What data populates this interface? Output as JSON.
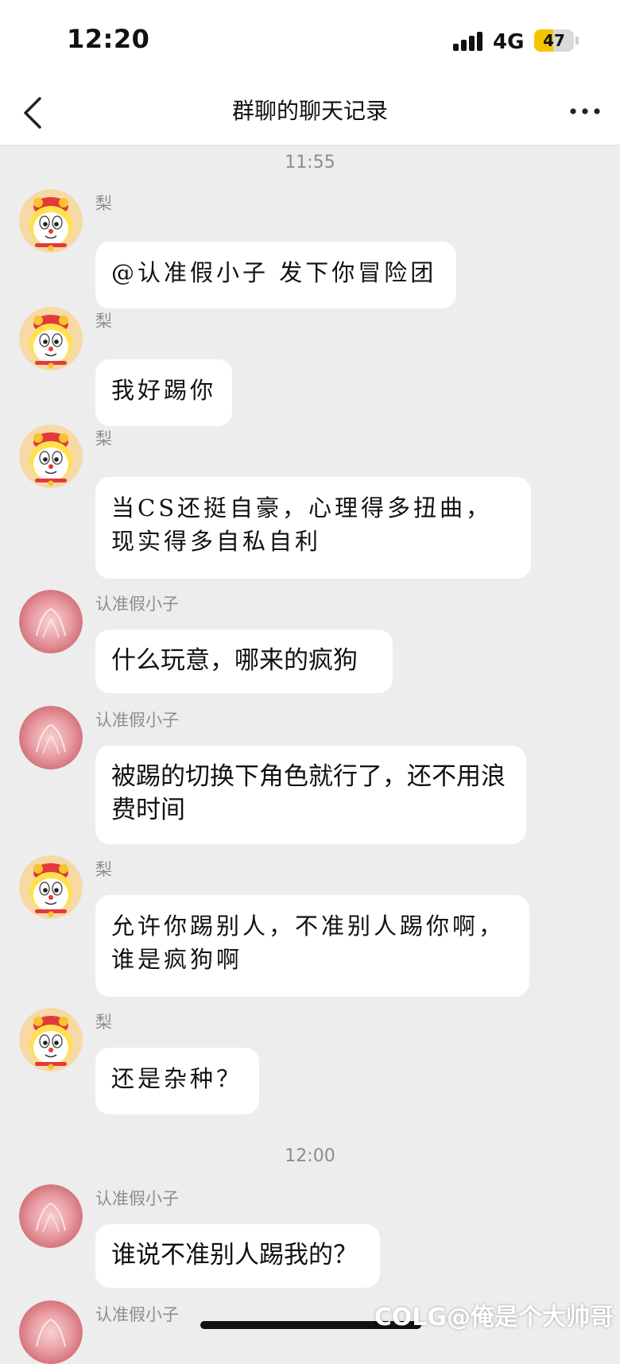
{
  "status_bar": {
    "time": "12:20",
    "network": "4G",
    "battery": "47",
    "battery_level": 0.47
  },
  "nav": {
    "title": "群聊的聊天记录",
    "back_icon": "chevron-left-icon",
    "more_icon": "more-dots-icon"
  },
  "timestamps": [
    "11:55",
    "12:00"
  ],
  "messages": [
    {
      "sender": "梨",
      "text": "@认准假小子 发下你冒险团"
    },
    {
      "sender": "梨",
      "text": "我好踢你"
    },
    {
      "sender": "梨",
      "text": "当CS还挺自豪，心理得多扭曲，现实得多自私自利"
    },
    {
      "sender": "认准假小子",
      "text": "什么玩意，哪来的疯狗"
    },
    {
      "sender": "认准假小子",
      "text": "被踢的切换下角色就行了，还不用浪费时间"
    },
    {
      "sender": "梨",
      "text": "允许你踢别人，不准别人踢你啊，谁是疯狗啊"
    },
    {
      "sender": "梨",
      "text": "还是杂种？"
    },
    {
      "sender": "认准假小子",
      "text": "谁说不准别人踢我的？"
    },
    {
      "sender": "认准假小子",
      "text": ""
    }
  ],
  "watermark": "COLG@俺是个大帅哥",
  "colors": {
    "background": "#ededed",
    "bubble": "#ffffff",
    "battery_accent": "#f5c400"
  }
}
